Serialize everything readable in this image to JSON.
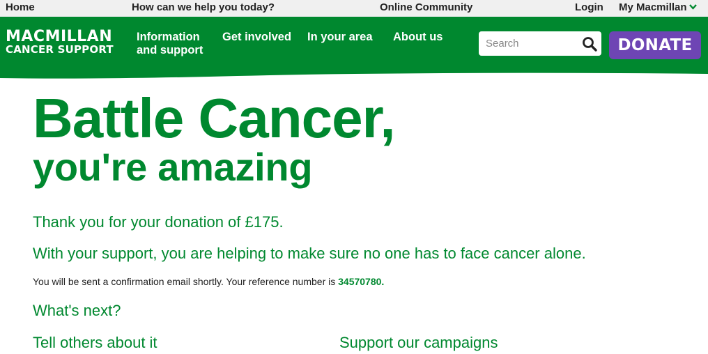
{
  "utility_nav": {
    "home": "Home",
    "help": "How can we help you today?",
    "community": "Online Community",
    "login": "Login",
    "my_macmillan": "My Macmillan"
  },
  "header": {
    "logo_line1": "MACMILLAN",
    "logo_line2": "CANCER SUPPORT",
    "nav": {
      "information": "Information and support",
      "get_involved": "Get involved",
      "in_your_area": "In your area",
      "about_us": "About us"
    },
    "search_placeholder": "Search",
    "donate_label": "DONATE"
  },
  "main": {
    "title_line1": "Battle Cancer,",
    "title_line2": "you're amazing",
    "thanks": "Thank you for your donation of £175.",
    "support": "With your support, you are helping to make sure no one has to face cancer alone.",
    "confirm_text": "You will be sent a confirmation email shortly. Your reference number is ",
    "reference_number": "34570780.",
    "whats_next": "What's next?",
    "tell_others": "Tell others about it",
    "support_campaigns": "Support our campaigns"
  },
  "colors": {
    "brand_green": "#00882f",
    "donate_purple": "#6e45b4",
    "utility_bg": "#f0f0f0"
  },
  "icons": {
    "search": "search-icon",
    "chevron": "chevron-down-icon"
  }
}
